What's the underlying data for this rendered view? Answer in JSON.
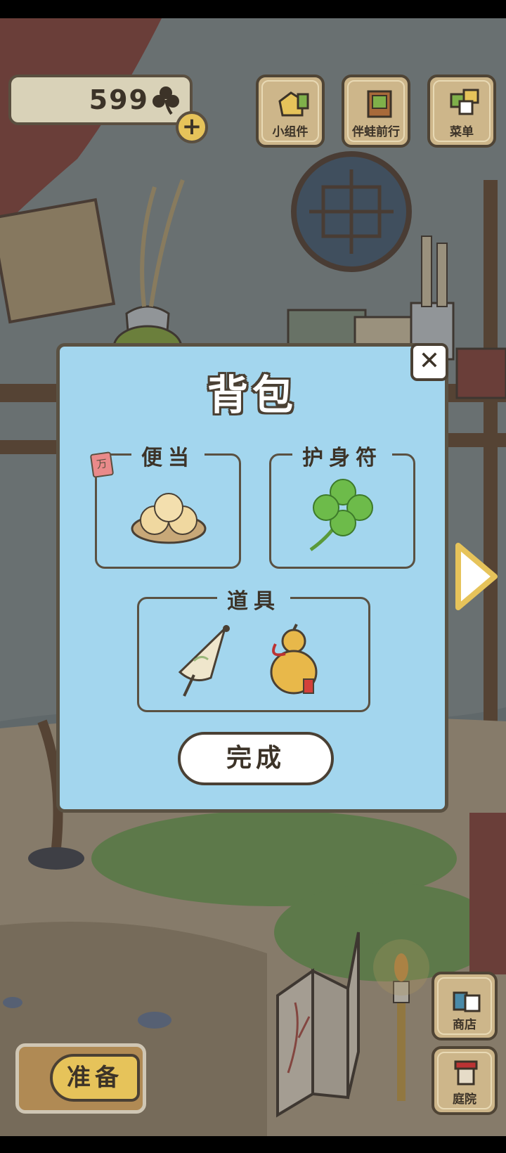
{
  "currency": {
    "amount": "599",
    "icon": "clover-icon"
  },
  "top_buttons": [
    {
      "name": "widget-button",
      "label": "小组件",
      "icon": "house-icon"
    },
    {
      "name": "travel-button",
      "label": "伴蛙前行",
      "icon": "book-icon"
    },
    {
      "name": "menu-button",
      "label": "菜单",
      "icon": "cards-icon"
    }
  ],
  "modal": {
    "title": "背包",
    "lunch_label": "便当",
    "lunch_tag": "万",
    "charm_label": "护身符",
    "tools_label": "道具",
    "done_label": "完成"
  },
  "side_buttons": {
    "shop_label": "商店",
    "yard_label": "庭院"
  },
  "prepare_label": "准备",
  "colors": {
    "modal_bg": "#a3d6ee",
    "wood": "#cdb68a",
    "gold": "#e6c35a",
    "outline": "#4a4034"
  }
}
